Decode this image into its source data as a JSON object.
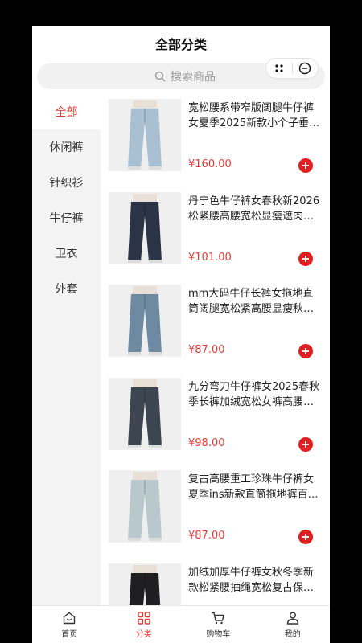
{
  "header": {
    "title": "全部分类"
  },
  "search": {
    "placeholder": "搜索商品"
  },
  "sidebar": {
    "items": [
      {
        "label": "全部",
        "active": true
      },
      {
        "label": "休闲裤",
        "active": false
      },
      {
        "label": "针织衫",
        "active": false
      },
      {
        "label": "牛仔裤",
        "active": false
      },
      {
        "label": "卫衣",
        "active": false
      },
      {
        "label": "外套",
        "active": false
      }
    ]
  },
  "products": [
    {
      "name": "宽松腰系带窄版阔腿牛仔裤女夏季2025新款小个子垂…",
      "price": "¥160.00",
      "jean_color": "#a9c0d3"
    },
    {
      "name": "丹宁色牛仔裤女春秋新2026松紧腰高腰宽松显瘦遮肉…",
      "price": "¥101.00",
      "jean_color": "#2b3446"
    },
    {
      "name": "mm大码牛仔长裤女拖地直筒阔腿宽松紧高腰显瘦秋…",
      "price": "¥87.00",
      "jean_color": "#6e8aa3"
    },
    {
      "name": "九分弯刀牛仔裤女2025春秋季长裤加绒宽松女裤高腰…",
      "price": "¥98.00",
      "jean_color": "#3d4550"
    },
    {
      "name": "复古高腰重工珍珠牛仔裤女夏季ins新款直筒拖地裤百…",
      "price": "¥87.00",
      "jean_color": "#b8c8cc"
    },
    {
      "name": "加绒加厚牛仔裤女秋冬季新款松紧腰抽绳宽松复古保…",
      "price": "",
      "jean_color": "#1f1f22"
    }
  ],
  "tabbar": {
    "items": [
      {
        "label": "首页",
        "icon": "home-icon",
        "active": false
      },
      {
        "label": "分类",
        "icon": "category-icon",
        "active": true
      },
      {
        "label": "购物车",
        "icon": "cart-icon",
        "active": false
      },
      {
        "label": "我的",
        "icon": "user-icon",
        "active": false
      }
    ]
  },
  "colors": {
    "accent": "#e53935",
    "add_button": "#e02020"
  }
}
